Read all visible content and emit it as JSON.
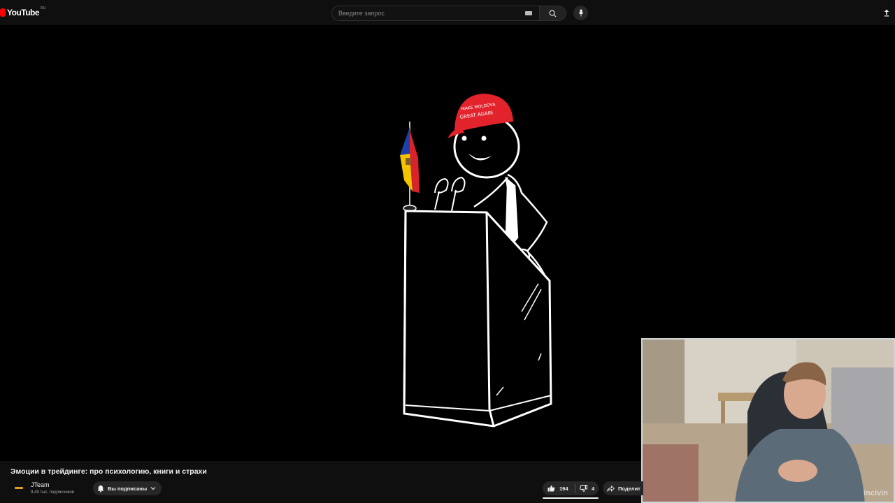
{
  "header": {
    "logo_text": "YouTube",
    "logo_region": "RU",
    "search_placeholder": "Введите запрос"
  },
  "video": {
    "cap_text_line1": "MAKE MOLDOVA",
    "cap_text_line2": "GREAT AGAIN",
    "title": "Эмоции в трейдинге: про психологию, книги и страхи"
  },
  "channel": {
    "name": "JTeam",
    "subscribers": "9,49 тыс. подписчиков",
    "subscribed_label": "Вы подписаны"
  },
  "actions": {
    "likes": "194",
    "dislikes": "4",
    "share_label": "Поделит"
  },
  "webcam": {
    "watermark": "incivin"
  },
  "colors": {
    "brand_red": "#ff0000",
    "cap_red": "#e3232c",
    "background": "#0f0f0f",
    "chip": "#272727"
  }
}
